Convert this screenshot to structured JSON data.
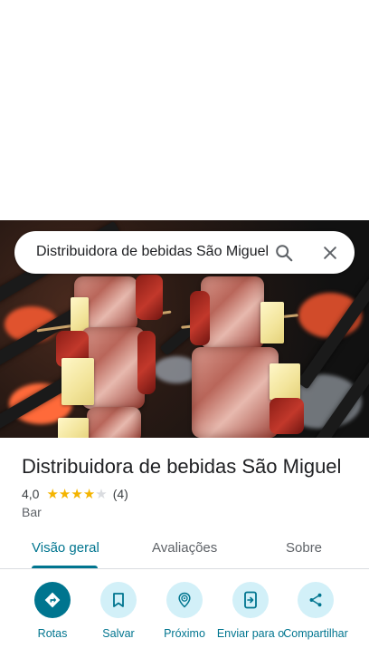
{
  "search": {
    "query": "Distribuidora de bebidas São Miguel",
    "search_icon": "search-icon",
    "close_icon": "close-icon"
  },
  "place": {
    "name": "Distribuidora de bebidas São Miguel",
    "rating": "4,0",
    "rating_value": 4.0,
    "rating_max": 5,
    "review_count": "(4)",
    "category": "Bar"
  },
  "tabs": [
    {
      "label": "Visão geral",
      "active": true
    },
    {
      "label": "Avaliações",
      "active": false
    },
    {
      "label": "Sobre",
      "active": false
    }
  ],
  "actions": [
    {
      "label": "Rotas",
      "icon": "directions-icon"
    },
    {
      "label": "Salvar",
      "icon": "bookmark-icon"
    },
    {
      "label": "Próximo",
      "icon": "nearby-icon"
    },
    {
      "label": "Enviar para o",
      "icon": "send-to-phone-icon"
    },
    {
      "label": "Compartilhar",
      "icon": "share-icon"
    }
  ],
  "colors": {
    "accent": "#00758f",
    "action_bg": "#d2f0f8",
    "star": "#f4b400",
    "star_empty": "#dadce0"
  }
}
